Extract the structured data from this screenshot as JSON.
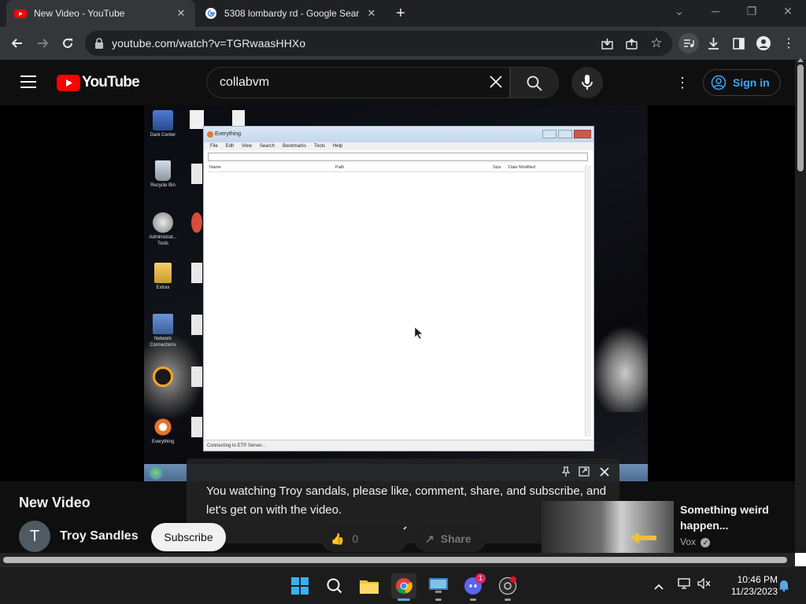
{
  "browser": {
    "tabs": [
      {
        "title": "New Video - YouTube",
        "active": true,
        "icon": "youtube-favicon"
      },
      {
        "title": "5308 lombardy rd - Google Sear",
        "active": false,
        "icon": "google-favicon"
      }
    ],
    "url": "youtube.com/watch?v=TGRwaasHHXo"
  },
  "youtube": {
    "logo_text": "YouTube",
    "search_value": "collabvm",
    "signin_label": "Sign in"
  },
  "vm_screen": {
    "desktop_icons": [
      {
        "label": "Dark Center"
      },
      {
        "label": "Recycle Bin"
      },
      {
        "label": "Administrat... Tools"
      },
      {
        "label": "Extras"
      },
      {
        "label": "Network Connections"
      },
      {
        "label": "Everything"
      }
    ],
    "everything_window": {
      "title": "Everything",
      "menu": [
        "File",
        "Edit",
        "View",
        "Search",
        "Bookmarks",
        "Tools",
        "Help"
      ],
      "columns": [
        "Name",
        "Path",
        "Size",
        "Date Modified"
      ],
      "status": "Connecting to ETP Server..."
    }
  },
  "caption": {
    "text": "You watching Troy sandals, please like, comment, share, and subscribe, and let's get on with the video."
  },
  "video_info": {
    "title": "New Video",
    "channel_initial": "T",
    "channel_name": "Troy Sandles",
    "subscribe_label": "Subscribe",
    "like_count": "0",
    "share_label": "Share"
  },
  "recommendation": {
    "title": "Something weird happen...",
    "channel": "Vox"
  },
  "taskbar": {
    "time": "10:46 PM",
    "date": "11/23/2023",
    "discord_badge": "1"
  },
  "colors": {
    "youtube_red": "#ff0000",
    "link_blue": "#3ea6ff",
    "chrome_dark": "#202124"
  }
}
